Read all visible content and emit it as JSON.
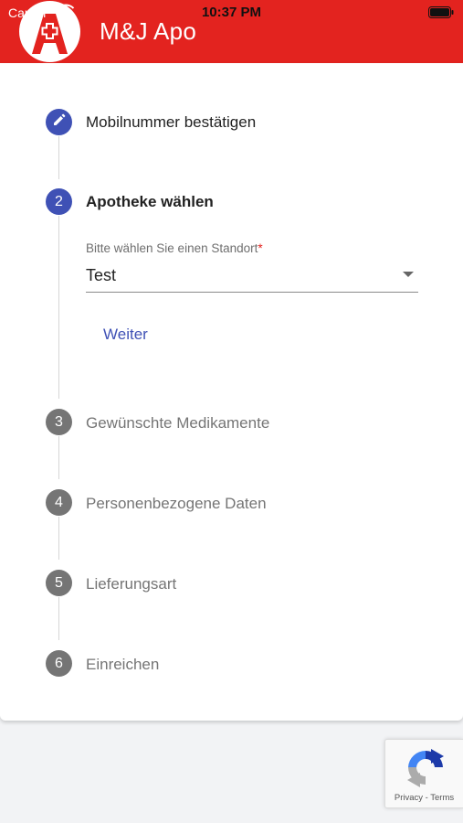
{
  "status_bar": {
    "carrier": "Carrier",
    "time": "10:37 PM"
  },
  "app_bar": {
    "title": "M&J Apo",
    "color": "#e3231f"
  },
  "steps": [
    {
      "number": "",
      "label": "Mobilnummer bestätigen",
      "state": "done",
      "icon": "pencil-icon"
    },
    {
      "number": "2",
      "label": "Apotheke wählen",
      "state": "active"
    },
    {
      "number": "3",
      "label": "Gewünschte Medikamente",
      "state": "inactive"
    },
    {
      "number": "4",
      "label": "Personenbezogene Daten",
      "state": "inactive"
    },
    {
      "number": "5",
      "label": "Lieferungsart",
      "state": "inactive"
    },
    {
      "number": "6",
      "label": "Einreichen",
      "state": "inactive"
    }
  ],
  "location_field": {
    "label": "Bitte wählen Sie einen Standort",
    "required_marker": "*",
    "value": "Test"
  },
  "next_button": "Weiter",
  "recaptcha": {
    "links": "Privacy - Terms"
  },
  "colors": {
    "accent": "#3f51b5",
    "inactive": "#757575",
    "brand": "#e3231f"
  }
}
